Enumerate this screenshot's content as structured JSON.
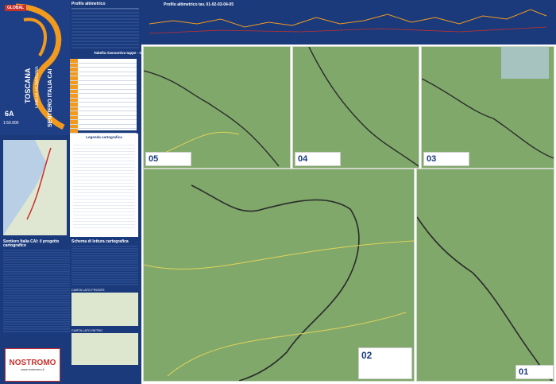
{
  "cover": {
    "brand": "GLOBAL",
    "title_main": "SENTIERO ITALIA CAI",
    "title_region": "TOSCANA",
    "title_region2": "EMILIA-ROMAGNA",
    "scale": "1:50.000",
    "map_number": "6A",
    "colors": {
      "blue": "#1e3f86",
      "orange": "#f29a1e"
    }
  },
  "profile": {
    "title": "Profilo altimetrico",
    "title_right": "Profilo altimetrico tav. 01-02-03-04-05"
  },
  "table": {
    "title": "Tabella riassuntiva tappe - Carta 6A"
  },
  "legend": {
    "title": "Legenda cartografica"
  },
  "bottom": {
    "col1_title": "Sentiero Italia CAI: il progetto cartografico",
    "col2_title": "Schema di lettura cartografica",
    "keymap_title": "CARTA LATO FRONTE",
    "keymap_title2": "CARTA LATO RETRO"
  },
  "sheets": [
    {
      "number": "05"
    },
    {
      "number": "04"
    },
    {
      "number": "03"
    },
    {
      "number": "02"
    },
    {
      "number": "01"
    }
  ],
  "logo": {
    "text": "NOSTROMO",
    "subtext": "www.nostromo.it"
  }
}
